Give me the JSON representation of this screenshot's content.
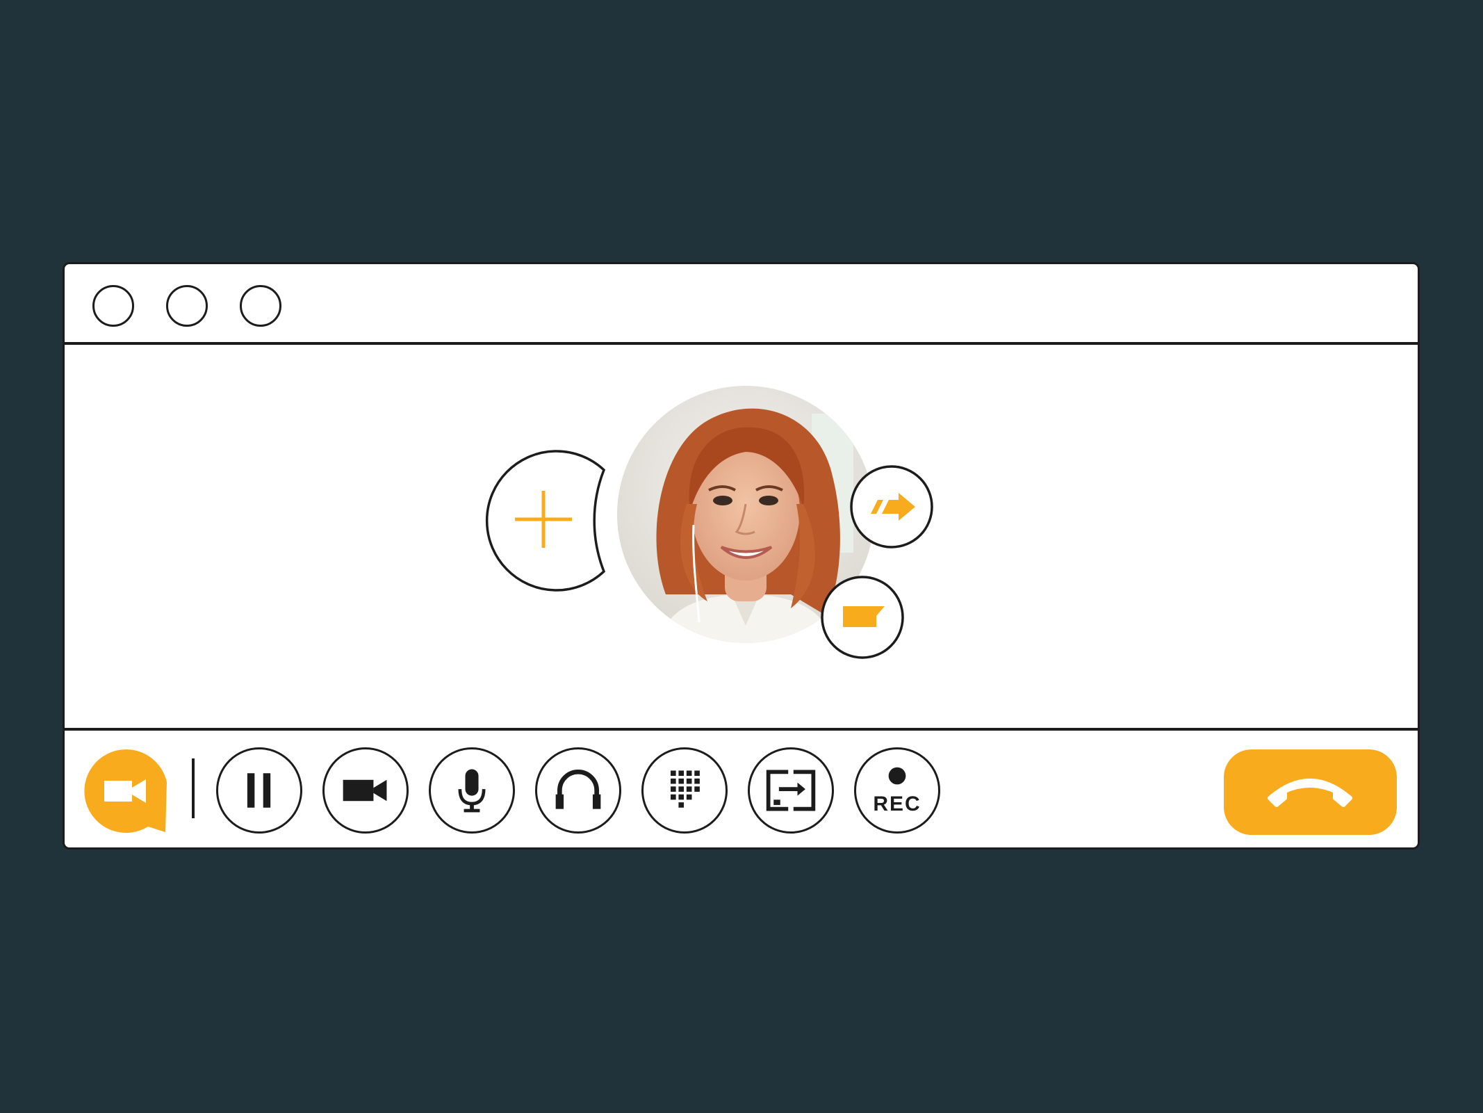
{
  "window": {
    "title_buttons": [
      "close",
      "minimize",
      "maximize"
    ]
  },
  "call": {
    "add_participant_icon": "plus-icon",
    "participant_avatar": "woman-portrait",
    "transfer_icon": "forward-arrow-icon",
    "chat_icon": "message-icon"
  },
  "toolbar": {
    "brand_icon": "video-chat-icon",
    "buttons": [
      {
        "icon": "pause-icon"
      },
      {
        "icon": "video-camera-icon"
      },
      {
        "icon": "microphone-icon"
      },
      {
        "icon": "headset-icon"
      },
      {
        "icon": "dialpad-icon"
      },
      {
        "icon": "screen-share-icon"
      },
      {
        "icon": "record-icon",
        "label": "REC"
      }
    ],
    "hangup_icon": "hang-up-phone-icon"
  },
  "colors": {
    "background": "#21333a",
    "accent": "#f8ab1c",
    "stroke": "#1c1c1c",
    "window": "#ffffff"
  }
}
